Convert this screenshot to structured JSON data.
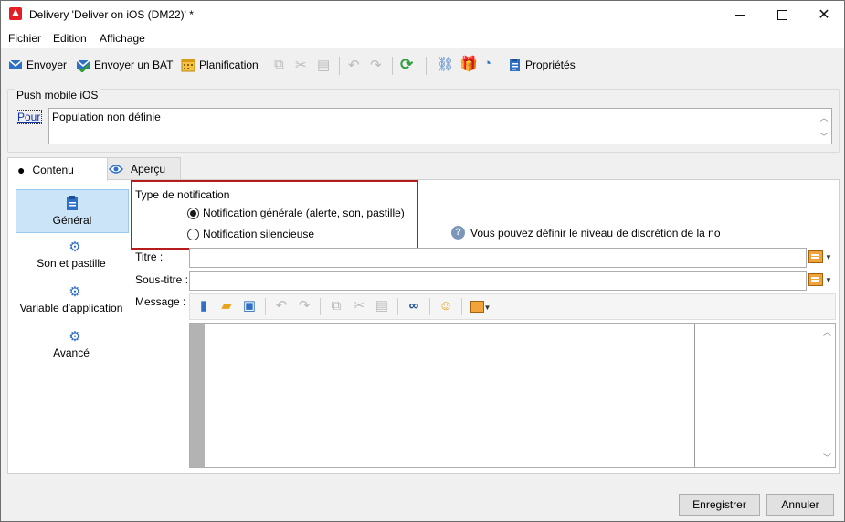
{
  "window": {
    "title": "Delivery 'Deliver on iOS (DM22)' *"
  },
  "menu": [
    "Fichier",
    "Edition",
    "Affichage"
  ],
  "toolbar": {
    "send": "Envoyer",
    "send_proof": "Envoyer un BAT",
    "schedule": "Planification",
    "properties": "Propriétés"
  },
  "push_group": {
    "label": "Push mobile iOS",
    "to_link": "Pour",
    "population": "Population non définie"
  },
  "tabs": [
    {
      "label": "Contenu",
      "icon": "apple-icon",
      "active": true
    },
    {
      "label": "Aperçu",
      "icon": "eye-icon",
      "active": false
    }
  ],
  "sidebar": [
    {
      "label": "Général",
      "icon": "clipboard-icon",
      "active": true
    },
    {
      "label": "Son et pastille",
      "icon": "gears-icon"
    },
    {
      "label": "Variable d'application",
      "icon": "gears-icon"
    },
    {
      "label": "Avancé",
      "icon": "gears-icon"
    }
  ],
  "notification": {
    "legend": "Type de notification",
    "option_general": "Notification générale (alerte, son, pastille)",
    "option_silent": "Notification silencieuse",
    "selected": "general",
    "help_text": "Vous pouvez définir le niveau de discrétion de la no"
  },
  "fields": {
    "title_label": "Titre :",
    "title_value": "",
    "subtitle_label": "Sous-titre :",
    "subtitle_value": "",
    "message_label": "Message :"
  },
  "buttons": {
    "save": "Enregistrer",
    "cancel": "Annuler"
  },
  "colors": {
    "accent": "#0078d7",
    "highlight_frame": "#b71c1c",
    "selection": "#cce4f7"
  }
}
